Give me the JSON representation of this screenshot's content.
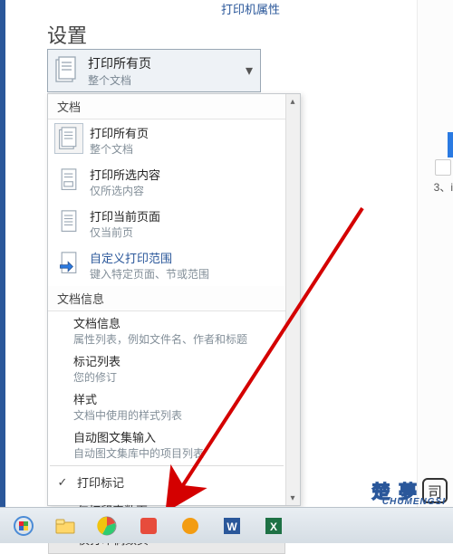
{
  "header": {
    "printer_props_link": "打印机属性",
    "settings_title": "设置"
  },
  "dropdown": {
    "line1": "打印所有页",
    "line2": "整个文档"
  },
  "menu": {
    "section_document": "文档",
    "items": [
      {
        "title": "打印所有页",
        "sub": "整个文档"
      },
      {
        "title": "打印所选内容",
        "sub": "仅所选内容"
      },
      {
        "title": "打印当前页面",
        "sub": "仅当前页"
      },
      {
        "title": "自定义打印范围",
        "sub": "键入特定页面、节或范围",
        "link": true
      }
    ],
    "section_doc_info": "文档信息",
    "info_items": [
      {
        "title": "文档信息",
        "sub": "属性列表，例如文件名、作者和标题"
      },
      {
        "title": "标记列表",
        "sub": "您的修订"
      },
      {
        "title": "样式",
        "sub": "文档中使用的样式列表"
      },
      {
        "title": "自动图文集输入",
        "sub": "自动图文集库中的项目列表"
      }
    ],
    "print_markup": "打印标记",
    "print_odd": "仅打印奇数页",
    "print_even": "仅打印偶数页"
  },
  "right": {
    "num": "3、i"
  },
  "watermark": {
    "cn": "楚 夢",
    "en": "CHUMENGSI",
    "icon": "司"
  }
}
